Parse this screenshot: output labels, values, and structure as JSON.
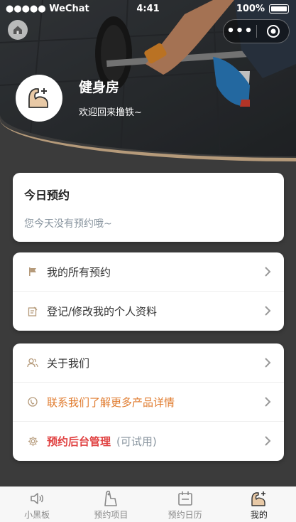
{
  "status_bar": {
    "carrier": "●●●●● WeChat",
    "time": "4:41",
    "battery": "100%"
  },
  "header": {
    "gym_name": "健身房",
    "welcome": "欢迎回来撸铁~"
  },
  "today_card": {
    "title": "今日预约",
    "empty_text": "您今天没有预约哦~"
  },
  "menu1": [
    {
      "label": "我的所有预约",
      "icon": "flag-icon"
    },
    {
      "label": "登记/修改我的个人资料",
      "icon": "edit-icon"
    }
  ],
  "menu2": [
    {
      "label": "关于我们",
      "icon": "users-icon"
    },
    {
      "label": "联系我们了解更多产品详情",
      "icon": "phone-icon",
      "color": "#e07b2e"
    },
    {
      "label": "预约后台管理",
      "suffix": "(可试用)",
      "icon": "gear-icon",
      "color": "#e04141"
    }
  ],
  "tabs": [
    {
      "label": "小黑板",
      "icon": "speaker-icon"
    },
    {
      "label": "预约项目",
      "icon": "equipment-icon"
    },
    {
      "label": "预约日历",
      "icon": "calendar-icon"
    },
    {
      "label": "我的",
      "icon": "muscle-icon",
      "active": true
    }
  ],
  "colors": {
    "accent": "#b59a7a",
    "orange": "#e07b2e",
    "red": "#e04141"
  }
}
